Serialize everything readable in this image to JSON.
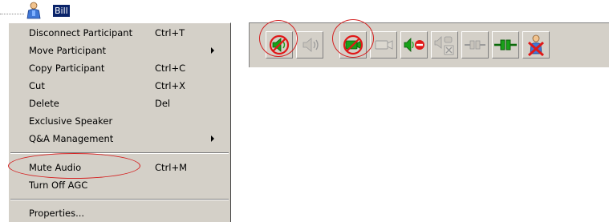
{
  "tree": {
    "user_label": "Bill"
  },
  "menu": {
    "items": [
      {
        "label": "Disconnect Participant",
        "shortcut": "Ctrl+T",
        "submenu": false
      },
      {
        "label": "Move Participant",
        "shortcut": "",
        "submenu": true
      },
      {
        "label": "Copy Participant",
        "shortcut": "Ctrl+C",
        "submenu": false
      },
      {
        "label": "Cut",
        "shortcut": "Ctrl+X",
        "submenu": false
      },
      {
        "label": "Delete",
        "shortcut": "Del",
        "submenu": false
      },
      {
        "label": "Exclusive Speaker",
        "shortcut": "",
        "submenu": false
      },
      {
        "label": "Q&A Management",
        "shortcut": "",
        "submenu": true
      },
      {
        "label": "Mute Audio",
        "shortcut": "Ctrl+M",
        "submenu": false,
        "highlighted_by_annotation": true
      },
      {
        "label": "Turn Off AGC",
        "shortcut": "",
        "submenu": false
      },
      {
        "label": "Properties...",
        "shortcut": "",
        "submenu": false
      }
    ]
  },
  "toolbar": {
    "buttons": [
      {
        "icon": "mute-audio-icon",
        "enabled": true,
        "circled": true
      },
      {
        "icon": "unmute-audio-icon",
        "enabled": false,
        "circled": false
      },
      {
        "icon": "video-off-icon",
        "enabled": true,
        "circled": true
      },
      {
        "icon": "video-on-icon",
        "enabled": false,
        "circled": false
      },
      {
        "icon": "speaker-block-icon",
        "enabled": true,
        "circled": false
      },
      {
        "icon": "speaker-disconnect-icon",
        "enabled": false,
        "circled": false
      },
      {
        "icon": "disconnect-plug-icon",
        "enabled": false,
        "circled": false
      },
      {
        "icon": "connect-plug-icon",
        "enabled": true,
        "circled": false
      },
      {
        "icon": "remove-participant-icon",
        "enabled": true,
        "circled": false
      }
    ]
  },
  "colors": {
    "menu_bg": "#d4d0c8",
    "selection": "#0a246a",
    "annotation_red": "#d42020",
    "icon_green": "#18a018",
    "icon_red": "#e01818",
    "disabled_gray": "#9a9a9a"
  }
}
